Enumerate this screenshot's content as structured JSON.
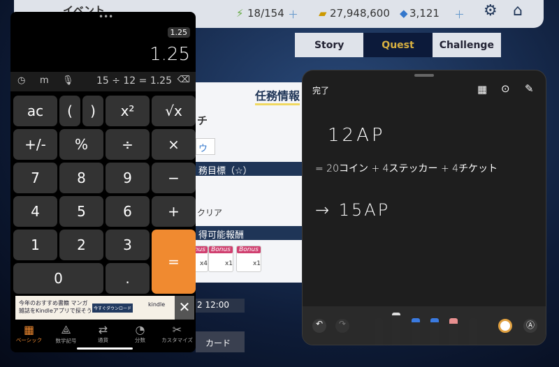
{
  "game": {
    "title": "イベント",
    "ap": "18/154",
    "coins": "27,948,600",
    "gems": "3,121",
    "tabs": [
      {
        "label": "Story"
      },
      {
        "label": "Quest"
      },
      {
        "label": "Challenge"
      }
    ],
    "dialog": {
      "title": "任務情報",
      "name_fragment": "チ",
      "button_fragment": "ウ",
      "section1": "務目標（☆）",
      "objective": "クリア",
      "section2": "得可能報酬",
      "rewards": [
        {
          "badge": "Bonus",
          "qty": "x4"
        },
        {
          "badge": "Bonus",
          "qty": "x1"
        },
        {
          "badge": "Bonus",
          "qty": "x1"
        }
      ]
    },
    "time_fragment": "2 12:00",
    "card_label": "カード"
  },
  "calculator": {
    "history_badge": "1.25",
    "display": "1.25",
    "expression": "15 ÷ 12 = 1.25",
    "memory_label": "m",
    "keys": [
      "ac",
      "(",
      ")",
      "x²",
      "√x",
      "+/-",
      "%",
      "÷",
      "×",
      "7",
      "8",
      "9",
      "−",
      "4",
      "5",
      "6",
      "+",
      "1",
      "2",
      "3",
      "=",
      "0",
      "."
    ],
    "ad": {
      "line1": "今年のおすすめ書籍 マンガ",
      "line2": "雑誌をKindleアプリで探そう",
      "cta": "今すぐダウンロード",
      "brand": "kindle"
    },
    "bottom_tabs": [
      {
        "label": "ベーシック",
        "active": true
      },
      {
        "label": "数学記号"
      },
      {
        "label": "通貨"
      },
      {
        "label": "分数"
      },
      {
        "label": "カスタマイズ"
      }
    ],
    "accent": "#f08a30"
  },
  "notes": {
    "done_label": "完了",
    "lines": [
      "12AP",
      "= 20コイン + 4ステッカー + 4チケット",
      "→ 15AP"
    ]
  }
}
